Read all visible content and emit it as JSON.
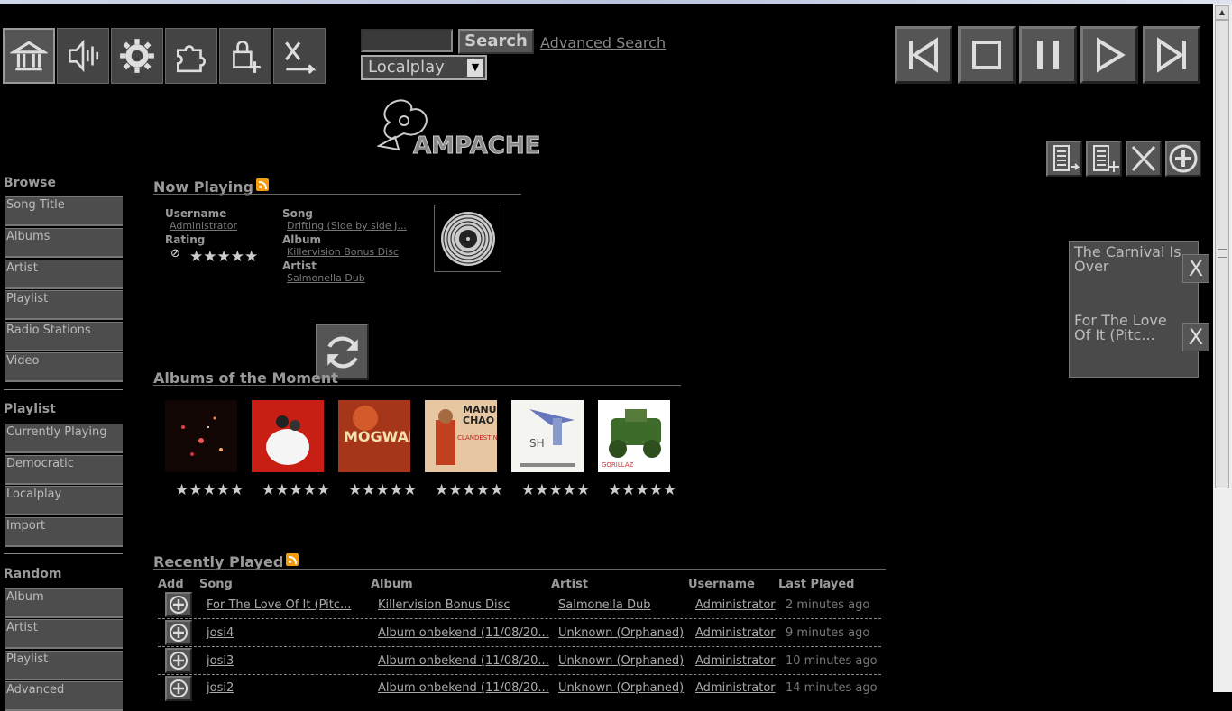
{
  "toolbar": {
    "buttons": [
      "home-icon",
      "volume-icon",
      "gear-icon",
      "plugin-icon",
      "lock-add-icon",
      "random-icon"
    ]
  },
  "search": {
    "button_label": "Search",
    "advanced_label": "Advanced Search",
    "player_select": "Localplay",
    "input_value": ""
  },
  "logo_text": "AMPACHE",
  "sidebar": {
    "browse_title": "Browse",
    "browse_items": [
      "Song Title",
      "Albums",
      "Artist",
      "Playlist",
      "Radio Stations",
      "Video"
    ],
    "playlist_title": "Playlist",
    "playlist_items": [
      "Currently Playing",
      "Democratic",
      "Localplay",
      "Import"
    ],
    "random_title": "Random",
    "random_items": [
      "Album",
      "Artist",
      "Playlist",
      "Advanced"
    ]
  },
  "now_playing": {
    "title": "Now Playing",
    "username_label": "Username",
    "username": "Administrator",
    "rating_label": "Rating",
    "song_label": "Song",
    "song": "Drifting (Side by side J...",
    "album_label": "Album",
    "album": "Killervision Bonus Disc",
    "artist_label": "Artist",
    "artist": "Salmonella Dub",
    "stars": "★★★★★"
  },
  "albums_moment": {
    "title": "Albums of the Moment",
    "stars": "★★★★★",
    "albums": [
      {
        "name": "dark-space-cover",
        "bg": "#1a0a05",
        "accent": "#d44"
      },
      {
        "name": "red-white-cover",
        "bg": "#c81e14",
        "accent": "#fff"
      },
      {
        "name": "mogwai-cover",
        "bg": "#b8401c",
        "accent": "#f2c14e",
        "text": "MOGWAI"
      },
      {
        "name": "manu-chao-cover",
        "bg": "#e8c9a0",
        "accent": "#c04020",
        "text": "MANU CHAO"
      },
      {
        "name": "guitar-cover",
        "bg": "#f2f2ee",
        "accent": "#5566aa"
      },
      {
        "name": "gorillaz-cover",
        "bg": "#ffffff",
        "accent": "#3d6b2a"
      }
    ]
  },
  "recently_played": {
    "title": "Recently Played",
    "headers": {
      "add": "Add",
      "song": "Song",
      "album": "Album",
      "artist": "Artist",
      "username": "Username",
      "last_played": "Last Played"
    },
    "rows": [
      {
        "song": "For The Love Of It (Pitc...",
        "album": "Killervision Bonus Disc",
        "artist": "Salmonella Dub",
        "user": "Administrator",
        "time": "2 minutes ago"
      },
      {
        "song": "josi4",
        "album": "Album onbekend (11/08/20...",
        "artist": "Unknown (Orphaned)",
        "user": "Administrator",
        "time": "9 minutes ago"
      },
      {
        "song": "josi3",
        "album": "Album onbekend (11/08/20...",
        "artist": "Unknown (Orphaned)",
        "user": "Administrator",
        "time": "10 minutes ago"
      },
      {
        "song": "josi2",
        "album": "Album onbekend (11/08/20...",
        "artist": "Unknown (Orphaned)",
        "user": "Administrator",
        "time": "14 minutes ago"
      }
    ]
  },
  "queue": {
    "items": [
      "The Carnival Is Over",
      "For The Love Of It (Pitc..."
    ],
    "remove_label": "X"
  }
}
